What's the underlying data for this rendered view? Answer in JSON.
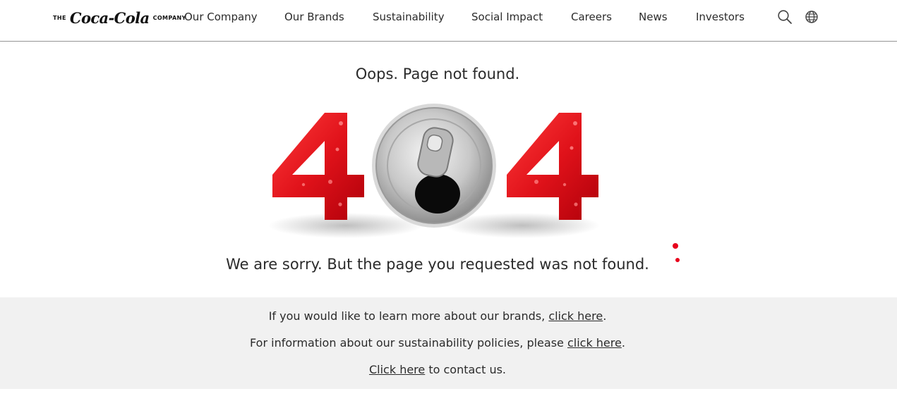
{
  "header": {
    "logo": {
      "prefix": "THE",
      "script": "Coca-Cola",
      "suffix": "COMPANY"
    },
    "nav": [
      "Our Company",
      "Our Brands",
      "Sustainability",
      "Social Impact",
      "Careers",
      "News",
      "Investors"
    ],
    "icons": [
      "search-icon",
      "globe-icon"
    ]
  },
  "main": {
    "title": "Oops. Page not found.",
    "error_code": "404",
    "message": "We are sorry. But the page you requested was not found."
  },
  "footer_links": {
    "line1_text": "If you would like to learn more about our brands, ",
    "line1_link": "click here",
    "line1_end": ".",
    "line2_text": "For information about our sustainability policies, please ",
    "line2_link": "click here",
    "line2_end": ".",
    "line3_link": "Click here",
    "line3_text": " to contact us."
  },
  "colors": {
    "brand_red": "#e8001c",
    "gray_band": "#f1f1f1"
  }
}
